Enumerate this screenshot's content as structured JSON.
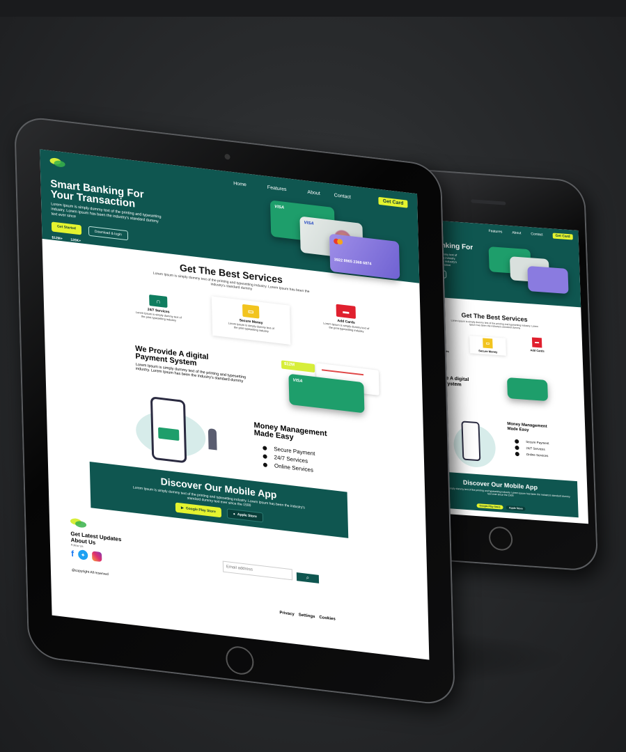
{
  "nav": {
    "links": [
      "Home",
      "Features",
      "About",
      "Contact"
    ],
    "cta": "Get Card"
  },
  "hero": {
    "title_line1": "Smart Banking For",
    "title_line2": "Your Transaction",
    "description": "Lorem Ipsum is simply dummy text of the printing and typesetting industry. Lorem Ipsum has been the industry's standard dummy text ever since",
    "primary_button": "Get Started",
    "secondary_button": "Download & login",
    "stats": [
      {
        "value": "$12M+",
        "label": "Customers"
      },
      {
        "value": "120K+",
        "label": "Total"
      }
    ],
    "card_number_main": "3922 8965 2368 6874",
    "card_visa": "VISA"
  },
  "services": {
    "title": "Get The Best Services",
    "subtitle": "Lorem Ipsum is simply dummy text of the printing and typesetting industry. Lorem Ipsum has been the industry's standard dummy",
    "items": [
      {
        "title": "24/7 Services",
        "text": "Lorem Ipsum is simply dummy text of the print typesetting industry"
      },
      {
        "title": "Secure Money",
        "text": "Lorem Ipsum is simply dummy text of the print typesetting industry"
      },
      {
        "title": "Add Cards",
        "text": "Lorem Ipsum is simply dummy text of the print typesetting industry"
      }
    ]
  },
  "payment": {
    "title_line1": "We Provide A digital",
    "title_line2": "Payment System",
    "text": "Lorem Ipsum is simply dummy text of the printing and typesetting industry. Lorem Ipsum has been the industry's standard dummy",
    "amount": "$12M"
  },
  "money": {
    "title_line1": "Money Management",
    "title_line2": "Made Easy",
    "bullets": [
      "Secure Payment",
      "24/7 Services",
      "Online Services"
    ]
  },
  "app": {
    "title": "Discover Our Mobile  App",
    "text": "Lorem Ipsum is simply dummy text of the printing and typesetting industry. Lorem Ipsum has been the industry's standard dummy text ever since the 1500",
    "google": "Google Play Store",
    "apple": "Apple Store"
  },
  "footer": {
    "title_line1": "Get Latest Updates",
    "title_line2": "About Us",
    "follow": "Follow Us",
    "email_placeholder": "Email address",
    "copyright": "@copyright All reserved",
    "links": [
      "Privacy",
      "Settings",
      "Cookies"
    ]
  },
  "colors": {
    "primary": "#0f5650",
    "accent": "#e4f32f",
    "green_card": "#1e9e6b",
    "purple_card": "#8a7be0",
    "red_icon": "#e0202e",
    "facebook": "#1877f2",
    "twitter": "#1da1f2"
  },
  "icons": [
    "headset-icon",
    "wallet-icon",
    "card-icon",
    "facebook-icon",
    "twitter-icon",
    "instagram-icon",
    "search-icon",
    "play-store-icon",
    "apple-icon"
  ]
}
